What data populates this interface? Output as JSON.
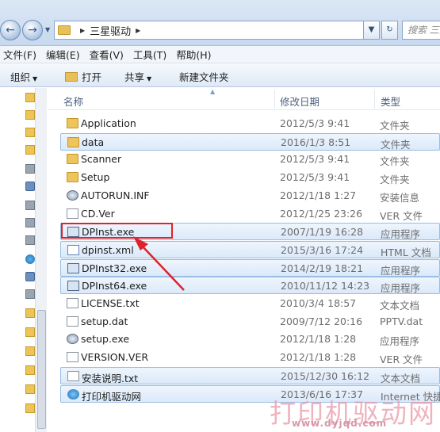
{
  "address": {
    "crumbs": [
      "三星驱动"
    ],
    "search_placeholder": "搜索 三星"
  },
  "menu": [
    "文件(F)",
    "编辑(E)",
    "查看(V)",
    "工具(T)",
    "帮助(H)"
  ],
  "toolbar": {
    "organize": "组织",
    "open": "打开",
    "share": "共享",
    "new_folder": "新建文件夹"
  },
  "columns": {
    "name": "名称",
    "modified": "修改日期",
    "type": "类型"
  },
  "files": [
    {
      "name": "Application",
      "date": "2012/5/3 9:41",
      "type": "文件夹",
      "icon": "folder",
      "selected": false
    },
    {
      "name": "data",
      "date": "2016/1/3 8:51",
      "type": "文件夹",
      "icon": "folder",
      "selected": true
    },
    {
      "name": "Scanner",
      "date": "2012/5/3 9:41",
      "type": "文件夹",
      "icon": "folder",
      "selected": false
    },
    {
      "name": "Setup",
      "date": "2012/5/3 9:41",
      "type": "文件夹",
      "icon": "folder",
      "selected": false
    },
    {
      "name": "AUTORUN.INF",
      "date": "2012/1/18 1:27",
      "type": "安装信息",
      "icon": "setup",
      "selected": false
    },
    {
      "name": "CD.Ver",
      "date": "2012/1/25 23:26",
      "type": "VER 文件",
      "icon": "page",
      "selected": false
    },
    {
      "name": "DPInst.exe",
      "date": "2007/1/19 16:28",
      "type": "应用程序",
      "icon": "exe",
      "selected": true
    },
    {
      "name": "dpinst.xml",
      "date": "2015/3/16 17:24",
      "type": "HTML 文档",
      "icon": "html",
      "selected": true
    },
    {
      "name": "DPInst32.exe",
      "date": "2014/2/19 18:21",
      "type": "应用程序",
      "icon": "exe",
      "selected": true
    },
    {
      "name": "DPInst64.exe",
      "date": "2010/11/12 14:23",
      "type": "应用程序",
      "icon": "exe",
      "selected": true
    },
    {
      "name": "LICENSE.txt",
      "date": "2010/3/4 18:57",
      "type": "文本文档",
      "icon": "page",
      "selected": false
    },
    {
      "name": "setup.dat",
      "date": "2009/7/12 20:16",
      "type": "PPTV.dat",
      "icon": "page",
      "selected": false
    },
    {
      "name": "setup.exe",
      "date": "2012/1/18 1:28",
      "type": "应用程序",
      "icon": "setup",
      "selected": false
    },
    {
      "name": "VERSION.VER",
      "date": "2012/1/18 1:28",
      "type": "VER 文件",
      "icon": "page",
      "selected": false
    },
    {
      "name": "安装说明.txt",
      "date": "2015/12/30 16:12",
      "type": "文本文档",
      "icon": "page",
      "selected": true
    },
    {
      "name": "打印机驱动网",
      "date": "2013/6/16 17:37",
      "type": "Internet 快捷",
      "icon": "ie",
      "selected": true
    }
  ],
  "watermark": {
    "title": "打印机驱动网",
    "url": "www.dyjqd.com"
  },
  "colors": {
    "highlight": "#e0222b",
    "selection_border": "#99bde3"
  }
}
